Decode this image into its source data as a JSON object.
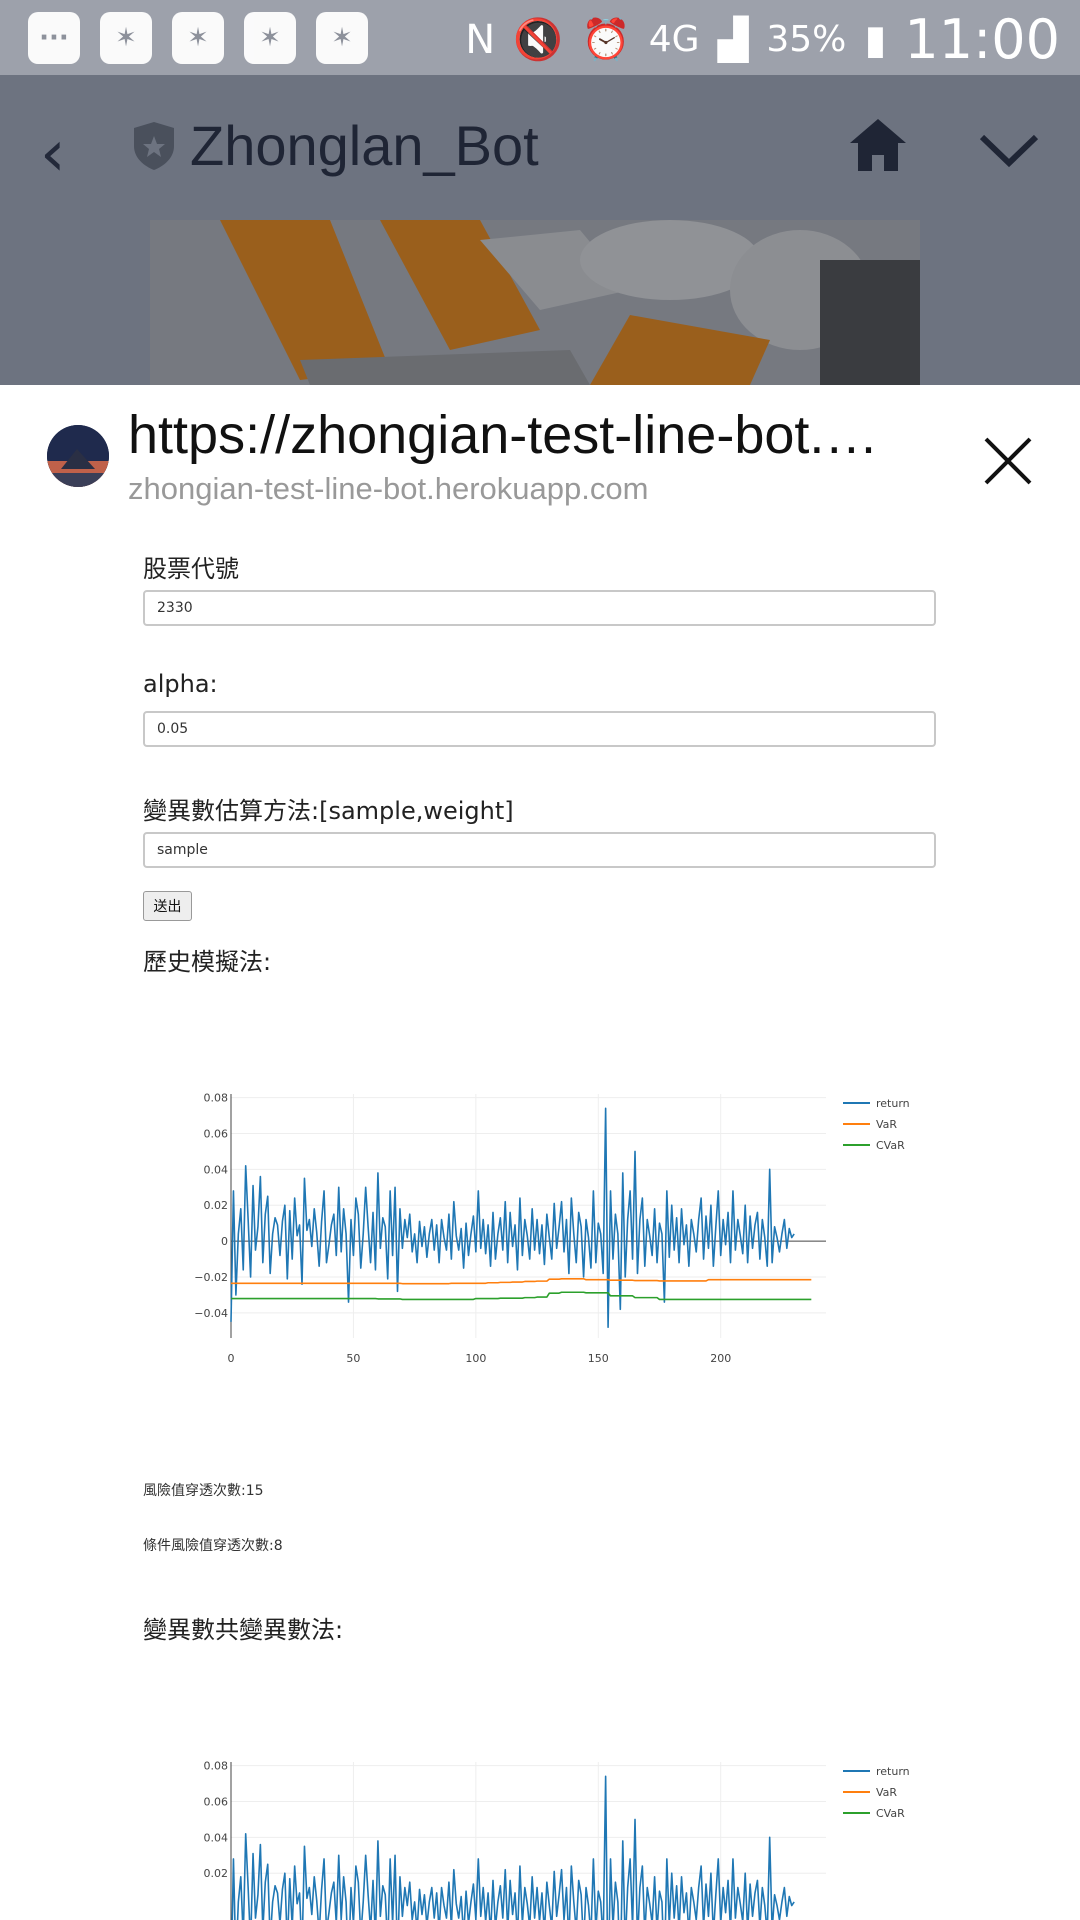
{
  "status_bar": {
    "battery": "35%",
    "time": "11:00",
    "network": "4G"
  },
  "app_bar": {
    "title": "Zhonglan_Bot"
  },
  "sheet": {
    "url_title": "https://zhongian-test-line-bot.…",
    "url_domain": "zhongian-test-line-bot.herokuapp.com"
  },
  "form": {
    "stock_label": "股票代號",
    "stock_value": "2330",
    "alpha_label": "alpha:",
    "alpha_value": "0.05",
    "method_label": "變異數估算方法:[sample,weight]",
    "method_value": "sample",
    "submit_label": "送出"
  },
  "results": {
    "section1_title": "歷史模擬法:",
    "var_breaches": "風險值穿透次數:15",
    "cvar_breaches": "條件風險值穿透次數:8",
    "section2_title": "變異數共變異數法:"
  },
  "colors": {
    "return": "#1f77b4",
    "var": "#ff7f0e",
    "cvar": "#2ca02c"
  },
  "chart_data": [
    {
      "type": "line",
      "xlim": [
        0,
        243
      ],
      "ylim": [
        -0.054,
        0.082
      ],
      "x_ticks": [
        "0",
        "50",
        "100",
        "150",
        "200"
      ],
      "y_ticks": [
        "0.08",
        "0.06",
        "0.04",
        "0.02",
        "0",
        "−0.02",
        "−0.04"
      ],
      "legend": [
        "return",
        "VaR",
        "CVaR"
      ],
      "legend_position": "right",
      "grid": true,
      "series": [
        {
          "name": "return",
          "values": [
            -0.045,
            0.028,
            -0.03,
            0.004,
            0.018,
            -0.016,
            0.042,
            0.012,
            -0.02,
            0.031,
            -0.005,
            0.008,
            0.036,
            -0.012,
            0.015,
            0.025,
            -0.018,
            0.004,
            0.013,
            0.009,
            -0.008,
            0.011,
            0.02,
            -0.021,
            0.017,
            -0.01,
            0.024,
            0.003,
            0.009,
            -0.024,
            0.035,
            0.006,
            0.012,
            -0.003,
            0.018,
            0.005,
            -0.014,
            0.011,
            0.028,
            -0.012,
            -0.002,
            0.009,
            0.015,
            -0.008,
            0.03,
            -0.006,
            0.018,
            0.004,
            -0.034,
            0.012,
            -0.008,
            0.024,
            0.015,
            -0.015,
            0.004,
            0.03,
            0.008,
            -0.012,
            0.016,
            -0.016,
            0.038,
            -0.004,
            0.013,
            0.008,
            -0.021,
            0.028,
            -0.008,
            0.03,
            -0.028,
            0.018,
            -0.004,
            0.012,
            0.002,
            0.015,
            -0.006,
            0.004,
            -0.012,
            0.011,
            -0.003,
            0.008,
            -0.009,
            0.004,
            0.012,
            -0.005,
            0.009,
            -0.012,
            0.012,
            0.002,
            -0.005,
            0.015,
            -0.01,
            0.022,
            0.003,
            -0.005,
            0.007,
            -0.015,
            0.01,
            -0.008,
            0.004,
            0.014,
            -0.006,
            0.028,
            -0.004,
            0.012,
            -0.007,
            0.009,
            -0.014,
            0.016,
            -0.01,
            0.004,
            0.013,
            -0.005,
            0.022,
            -0.012,
            0.016,
            -0.003,
            0.009,
            -0.016,
            0.024,
            -0.008,
            0.012,
            0.003,
            -0.01,
            0.018,
            -0.005,
            0.012,
            -0.007,
            0.009,
            -0.013,
            0.015,
            0.002,
            -0.01,
            0.021,
            -0.004,
            0.008,
            0.022,
            -0.006,
            0.012,
            -0.018,
            0.024,
            0.004,
            -0.012,
            0.016,
            0.008,
            -0.02,
            0.012,
            0.002,
            -0.015,
            0.028,
            -0.012,
            0.01,
            0.004,
            -0.018,
            0.074,
            -0.048,
            0.028,
            -0.01,
            0.015,
            0.004,
            -0.038,
            0.038,
            -0.02,
            0.012,
            0.028,
            -0.01,
            0.05,
            -0.018,
            0.012,
            0.024,
            -0.014,
            0.012,
            0.003,
            -0.008,
            0.018,
            -0.012,
            0.01,
            0.004,
            -0.034,
            0.028,
            -0.009,
            0.02,
            -0.005,
            0.013,
            -0.012,
            0.018,
            -0.002,
            0.009,
            -0.014,
            0.012,
            0.004,
            -0.006,
            0.012,
            0.024,
            -0.01,
            0.014,
            -0.004,
            0.02,
            -0.014,
            0.008,
            0.028,
            -0.008,
            0.012,
            -0.002,
            0.016,
            -0.012,
            0.028,
            -0.005,
            0.012,
            0.003,
            -0.007,
            0.02,
            -0.012,
            0.014,
            -0.004,
            0.009,
            0.016,
            -0.01,
            0.012,
            0.002,
            -0.014,
            0.04,
            -0.012,
            0.008,
            0.002,
            -0.006,
            0.004,
            0.012,
            -0.004,
            0.007,
            0.002,
            0.004
          ]
        },
        {
          "name": "VaR",
          "values": [
            -0.0235,
            -0.0235,
            -0.0235,
            -0.0235,
            -0.0235,
            -0.0235,
            -0.0235,
            -0.0235,
            -0.0235,
            -0.0235,
            -0.0235,
            -0.0235,
            -0.0235,
            -0.0235,
            -0.0235,
            -0.0235,
            -0.0235,
            -0.0235,
            -0.0235,
            -0.0235,
            -0.0235,
            -0.0235,
            -0.0235,
            -0.0235,
            -0.0235,
            -0.0235,
            -0.0235,
            -0.0235,
            -0.0235,
            -0.0235,
            -0.0235,
            -0.0235,
            -0.0235,
            -0.0235,
            -0.0235,
            -0.0235,
            -0.0235,
            -0.0235,
            -0.0235,
            -0.0235,
            -0.0235,
            -0.0235,
            -0.0235,
            -0.0235,
            -0.0235,
            -0.0235,
            -0.0235,
            -0.0235,
            -0.0235,
            -0.0235,
            -0.0235,
            -0.0235,
            -0.0235,
            -0.0235,
            -0.0235,
            -0.0235,
            -0.0235,
            -0.0235,
            -0.0235,
            -0.0235,
            -0.0235,
            -0.0235,
            -0.0235,
            -0.0235,
            -0.0235,
            -0.0235,
            -0.0235,
            -0.0235,
            -0.0235,
            -0.0235,
            -0.0237,
            -0.0237,
            -0.0237,
            -0.0237,
            -0.0237,
            -0.0237,
            -0.0237,
            -0.0237,
            -0.0237,
            -0.0237,
            -0.0237,
            -0.0237,
            -0.0237,
            -0.0237,
            -0.0237,
            -0.0237,
            -0.0237,
            -0.0237,
            -0.0237,
            -0.0237,
            -0.0235,
            -0.0235,
            -0.0235,
            -0.0235,
            -0.0235,
            -0.0235,
            -0.0235,
            -0.0235,
            -0.0235,
            -0.0235,
            -0.0235,
            -0.0235,
            -0.0235,
            -0.0235,
            -0.0235,
            -0.0232,
            -0.0232,
            -0.0232,
            -0.0232,
            -0.0232,
            -0.023,
            -0.023,
            -0.023,
            -0.023,
            -0.023,
            -0.0228,
            -0.0228,
            -0.0228,
            -0.0228,
            -0.0228,
            -0.0225,
            -0.0225,
            -0.0225,
            -0.0225,
            -0.0225,
            -0.0223,
            -0.0223,
            -0.0223,
            -0.0223,
            -0.0223,
            -0.0212,
            -0.0212,
            -0.0212,
            -0.0212,
            -0.0212,
            -0.021,
            -0.021,
            -0.021,
            -0.021,
            -0.021,
            -0.021,
            -0.021,
            -0.021,
            -0.021,
            -0.021,
            -0.0215,
            -0.0215,
            -0.0215,
            -0.0215,
            -0.0215,
            -0.0215,
            -0.0215,
            -0.0215,
            -0.0215,
            -0.0215,
            -0.0218,
            -0.0218,
            -0.0218,
            -0.0218,
            -0.0218,
            -0.0218,
            -0.0218,
            -0.0218,
            -0.0218,
            -0.0218,
            -0.022,
            -0.022,
            -0.022,
            -0.022,
            -0.022,
            -0.022,
            -0.022,
            -0.022,
            -0.022,
            -0.022,
            -0.0222,
            -0.0222,
            -0.0222,
            -0.0222,
            -0.0222,
            -0.0222,
            -0.0222,
            -0.0222,
            -0.0222,
            -0.0222,
            -0.0222,
            -0.0222,
            -0.0222,
            -0.0222,
            -0.0222,
            -0.0222,
            -0.0222,
            -0.0222,
            -0.0222,
            -0.0222,
            -0.0215,
            -0.0215,
            -0.0215,
            -0.0215,
            -0.0215,
            -0.0215,
            -0.0215,
            -0.0215,
            -0.0215,
            -0.0215,
            -0.0215,
            -0.0215,
            -0.0215,
            -0.0215,
            -0.0215,
            -0.0215,
            -0.0215,
            -0.0215,
            -0.0215,
            -0.0215,
            -0.0215,
            -0.0215,
            -0.0215,
            -0.0215,
            -0.0215,
            -0.0215,
            -0.0215,
            -0.0215,
            -0.0215,
            -0.0215,
            -0.0215,
            -0.0215,
            -0.0215,
            -0.0215,
            -0.0215,
            -0.0215,
            -0.0215,
            -0.0215,
            -0.0215,
            -0.0215,
            -0.0215,
            -0.0215,
            -0.0215
          ]
        },
        {
          "name": "CVaR",
          "values": [
            -0.032,
            -0.032,
            -0.032,
            -0.032,
            -0.032,
            -0.032,
            -0.032,
            -0.032,
            -0.032,
            -0.032,
            -0.032,
            -0.032,
            -0.032,
            -0.032,
            -0.032,
            -0.032,
            -0.032,
            -0.032,
            -0.032,
            -0.032,
            -0.032,
            -0.032,
            -0.032,
            -0.032,
            -0.032,
            -0.032,
            -0.032,
            -0.032,
            -0.032,
            -0.032,
            -0.032,
            -0.032,
            -0.032,
            -0.032,
            -0.032,
            -0.032,
            -0.032,
            -0.032,
            -0.032,
            -0.032,
            -0.032,
            -0.032,
            -0.032,
            -0.032,
            -0.032,
            -0.032,
            -0.032,
            -0.032,
            -0.032,
            -0.032,
            -0.032,
            -0.032,
            -0.032,
            -0.032,
            -0.032,
            -0.032,
            -0.032,
            -0.032,
            -0.032,
            -0.032,
            -0.0322,
            -0.0322,
            -0.0322,
            -0.0322,
            -0.0322,
            -0.0322,
            -0.0322,
            -0.0322,
            -0.0322,
            -0.0322,
            -0.0325,
            -0.0325,
            -0.0325,
            -0.0325,
            -0.0325,
            -0.0325,
            -0.0325,
            -0.0325,
            -0.0325,
            -0.0325,
            -0.0325,
            -0.0325,
            -0.0325,
            -0.0325,
            -0.0325,
            -0.0325,
            -0.0325,
            -0.0325,
            -0.0325,
            -0.0325,
            -0.0325,
            -0.0325,
            -0.0325,
            -0.0325,
            -0.0325,
            -0.0325,
            -0.0325,
            -0.0325,
            -0.0325,
            -0.0325,
            -0.032,
            -0.032,
            -0.032,
            -0.032,
            -0.032,
            -0.032,
            -0.032,
            -0.032,
            -0.032,
            -0.032,
            -0.0318,
            -0.0318,
            -0.0318,
            -0.0318,
            -0.0318,
            -0.0318,
            -0.0318,
            -0.0318,
            -0.0318,
            -0.0318,
            -0.0315,
            -0.0315,
            -0.0315,
            -0.0315,
            -0.0315,
            -0.0312,
            -0.0312,
            -0.0312,
            -0.0312,
            -0.0312,
            -0.029,
            -0.029,
            -0.029,
            -0.029,
            -0.029,
            -0.0285,
            -0.0285,
            -0.0285,
            -0.0285,
            -0.0285,
            -0.0285,
            -0.0285,
            -0.0285,
            -0.0285,
            -0.0285,
            -0.0288,
            -0.0288,
            -0.0288,
            -0.0288,
            -0.0288,
            -0.0288,
            -0.0288,
            -0.0288,
            -0.0288,
            -0.0288,
            -0.0305,
            -0.0305,
            -0.0305,
            -0.0305,
            -0.0305,
            -0.0305,
            -0.0305,
            -0.0305,
            -0.0305,
            -0.0305,
            -0.0315,
            -0.0315,
            -0.0315,
            -0.0315,
            -0.0315,
            -0.0315,
            -0.0315,
            -0.0315,
            -0.0315,
            -0.0315,
            -0.0325,
            -0.0325,
            -0.0325,
            -0.0325,
            -0.0325,
            -0.0325,
            -0.0325,
            -0.0325,
            -0.0325,
            -0.0325,
            -0.0325,
            -0.0325,
            -0.0325,
            -0.0325,
            -0.0325,
            -0.0325,
            -0.0325,
            -0.0325,
            -0.0325,
            -0.0325,
            -0.0325,
            -0.0325,
            -0.0325,
            -0.0325,
            -0.0325,
            -0.0325,
            -0.0325,
            -0.0325,
            -0.0325,
            -0.0325,
            -0.0325,
            -0.0325,
            -0.0325,
            -0.0325,
            -0.0325,
            -0.0325,
            -0.0325,
            -0.0325,
            -0.0325,
            -0.0325,
            -0.0325,
            -0.0325,
            -0.0325,
            -0.0325,
            -0.0325,
            -0.0325,
            -0.0325,
            -0.0325,
            -0.0325,
            -0.0325,
            -0.0325,
            -0.0325,
            -0.0325,
            -0.0325,
            -0.0325,
            -0.0325,
            -0.0325,
            -0.0325,
            -0.0325,
            -0.0325,
            -0.0325,
            -0.0325,
            -0.0325
          ]
        }
      ]
    },
    {
      "type": "line",
      "xlim": [
        0,
        243
      ],
      "ylim": [
        -0.054,
        0.082
      ],
      "x_ticks": [],
      "y_ticks": [
        "0.08",
        "0.06",
        "0.04",
        "0.02"
      ],
      "legend": [
        "return",
        "VaR",
        "CVaR"
      ],
      "legend_position": "right",
      "grid": true,
      "series": [
        {
          "name": "return",
          "values": "same-as-above"
        }
      ]
    }
  ]
}
